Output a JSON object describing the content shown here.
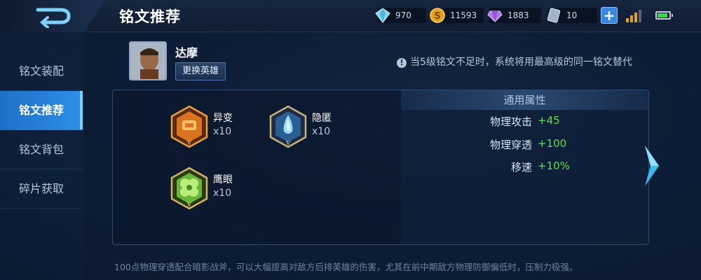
{
  "header": {
    "title": "铭文推荐",
    "resources": [
      {
        "icon": "diamond-icon",
        "value": "970"
      },
      {
        "icon": "gold-coin-icon",
        "value": "11593"
      },
      {
        "icon": "purple-crystal-icon",
        "value": "1883"
      },
      {
        "icon": "voucher-icon",
        "value": "10"
      }
    ],
    "plus_label": "+"
  },
  "sidebar": {
    "items": [
      {
        "label": "铭文装配",
        "active": false
      },
      {
        "label": "铭文推荐",
        "active": true
      },
      {
        "label": "铭文背包",
        "active": false
      },
      {
        "label": "碎片获取",
        "active": false
      }
    ]
  },
  "hero": {
    "name": "达摩",
    "change_label": "更换英雄"
  },
  "notice": "当5级铭文不足时，系统将用最高级的同一铭文替代",
  "runes": [
    {
      "name": "异变",
      "count": "x10",
      "color": "#d9731f"
    },
    {
      "name": "隐匿",
      "count": "x10",
      "color": "#3a8fd6"
    },
    {
      "name": "鹰眼",
      "count": "x10",
      "color": "#6ab43a"
    }
  ],
  "attributes": {
    "header": "通用属性",
    "rows": [
      {
        "label": "物理攻击",
        "value": "+45"
      },
      {
        "label": "物理穿透",
        "value": "+100"
      },
      {
        "label": "移速",
        "value": "+10%"
      }
    ]
  },
  "description": "100点物理穿透配合暗影战斧，可以大幅提高对敌方后排英雄的伤害，尤其在前中期敌方物理防御偏低时，压制力极强。",
  "colors": {
    "accent": "#2e8fe6",
    "positive": "#5fe04b"
  }
}
